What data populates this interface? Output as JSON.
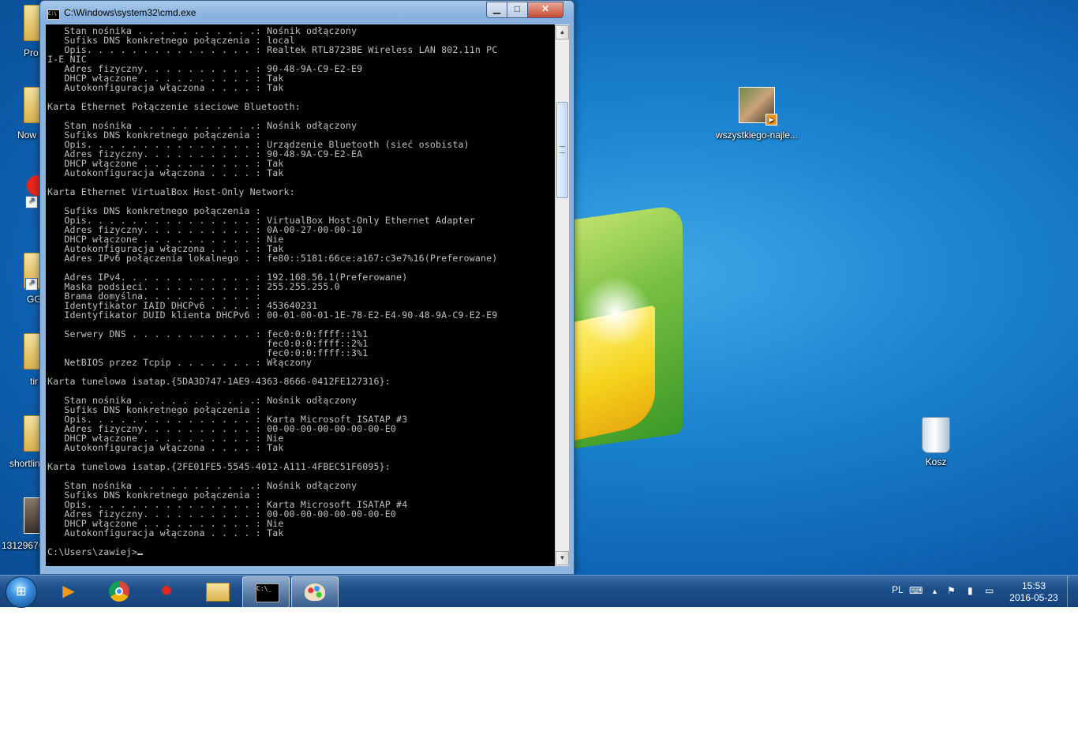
{
  "window": {
    "title": "C:\\Windows\\system32\\cmd.exe",
    "buttons": {
      "minimize": "▁",
      "maximize": "□",
      "close": "✕"
    },
    "console_lines": [
      "   Stan nośnika . . . . . . . . . . .: Nośnik odłączony",
      "   Sufiks DNS konkretnego połączenia : local",
      "   Opis. . . . . . . . . . . . . . . : Realtek RTL8723BE Wireless LAN 802.11n PC",
      "I-E NIC",
      "   Adres fizyczny. . . . . . . . . . : 90-48-9A-C9-E2-E9",
      "   DHCP włączone . . . . . . . . . . : Tak",
      "   Autokonfiguracja włączona . . . . : Tak",
      "",
      "Karta Ethernet Połączenie sieciowe Bluetooth:",
      "",
      "   Stan nośnika . . . . . . . . . . .: Nośnik odłączony",
      "   Sufiks DNS konkretnego połączenia :",
      "   Opis. . . . . . . . . . . . . . . : Urządzenie Bluetooth (sieć osobista)",
      "   Adres fizyczny. . . . . . . . . . : 90-48-9A-C9-E2-EA",
      "   DHCP włączone . . . . . . . . . . : Tak",
      "   Autokonfiguracja włączona . . . . : Tak",
      "",
      "Karta Ethernet VirtualBox Host-Only Network:",
      "",
      "   Sufiks DNS konkretnego połączenia :",
      "   Opis. . . . . . . . . . . . . . . : VirtualBox Host-Only Ethernet Adapter",
      "   Adres fizyczny. . . . . . . . . . : 0A-00-27-00-00-10",
      "   DHCP włączone . . . . . . . . . . : Nie",
      "   Autokonfiguracja włączona . . . . : Tak",
      "   Adres IPv6 połączenia lokalnego . : fe80::5181:66ce:a167:c3e7%16(Preferowane)",
      "",
      "   Adres IPv4. . . . . . . . . . . . : 192.168.56.1(Preferowane)",
      "   Maska podsieci. . . . . . . . . . : 255.255.255.0",
      "   Brama domyślna. . . . . . . . . . :",
      "   Identyfikator IAID DHCPv6 . . . . : 453640231",
      "   Identyfikator DUID klienta DHCPv6 : 00-01-00-01-1E-78-E2-E4-90-48-9A-C9-E2-E9",
      "",
      "   Serwery DNS . . . . . . . . . . . : fec0:0:0:ffff::1%1",
      "                                       fec0:0:0:ffff::2%1",
      "                                       fec0:0:0:ffff::3%1",
      "   NetBIOS przez Tcpip . . . . . . . : Włączony",
      "",
      "Karta tunelowa isatap.{5DA3D747-1AE9-4363-8666-0412FE127316}:",
      "",
      "   Stan nośnika . . . . . . . . . . .: Nośnik odłączony",
      "   Sufiks DNS konkretnego połączenia :",
      "   Opis. . . . . . . . . . . . . . . : Karta Microsoft ISATAP #3",
      "   Adres fizyczny. . . . . . . . . . : 00-00-00-00-00-00-00-E0",
      "   DHCP włączone . . . . . . . . . . : Nie",
      "   Autokonfiguracja włączona . . . . : Tak",
      "",
      "Karta tunelowa isatap.{2FE01FE5-5545-4012-A111-4FBEC51F6095}:",
      "",
      "   Stan nośnika . . . . . . . . . . .: Nośnik odłączony",
      "   Sufiks DNS konkretnego połączenia :",
      "   Opis. . . . . . . . . . . . . . . : Karta Microsoft ISATAP #4",
      "   Adres fizyczny. . . . . . . . . . : 00-00-00-00-00-00-00-E0",
      "   DHCP włączone . . . . . . . . . . : Nie",
      "   Autokonfiguracja włączona . . . . : Tak",
      "",
      "C:\\Users\\zawiej>"
    ]
  },
  "desktop": {
    "left_icons": [
      "Pro",
      "Now",
      "GG",
      "tir",
      "shortlin",
      "13129676"
    ],
    "right_icons": {
      "photo_label": "wszystkiego-najle...",
      "recycle_label": "Kosz"
    }
  },
  "taskbar": {
    "apps": [
      "media-player-icon",
      "chrome-icon",
      "sun-app-icon",
      "explorer-icon",
      "cmd-icon",
      "paint-icon"
    ],
    "lang": "PL",
    "time": "15:53",
    "date": "2016-05-23"
  }
}
